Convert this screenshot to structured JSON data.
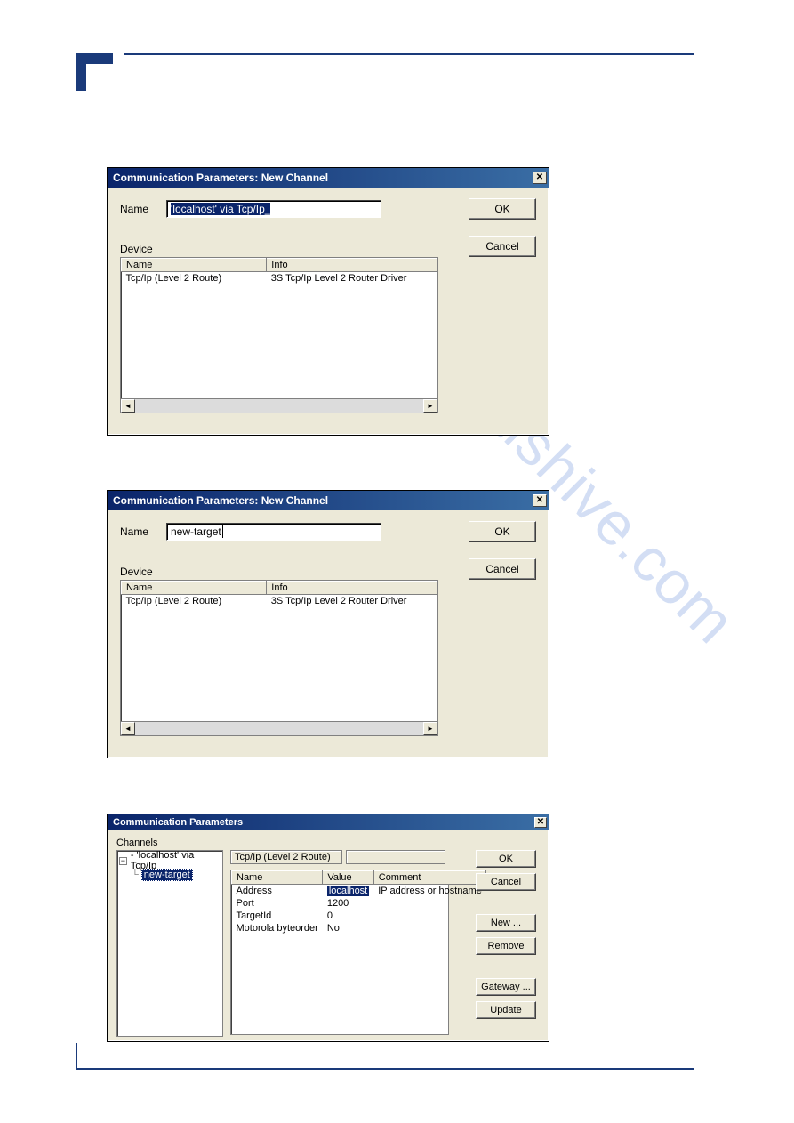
{
  "watermark": "manualshive.com",
  "dialog1": {
    "title": "Communication Parameters: New Channel",
    "name_label": "Name",
    "name_value": "'localhost' via Tcp/Ip_",
    "device_label": "Device",
    "cols": {
      "name": "Name",
      "info": "Info"
    },
    "row": {
      "name": "Tcp/Ip (Level 2 Route)",
      "info": "3S Tcp/Ip Level 2 Router Driver"
    },
    "ok": "OK",
    "cancel": "Cancel",
    "close": "✕"
  },
  "dialog2": {
    "title": "Communication Parameters: New Channel",
    "name_label": "Name",
    "name_value": "new-target",
    "device_label": "Device",
    "cols": {
      "name": "Name",
      "info": "Info"
    },
    "row": {
      "name": "Tcp/Ip (Level 2 Route)",
      "info": "3S Tcp/Ip Level 2 Router Driver"
    },
    "ok": "OK",
    "cancel": "Cancel",
    "close": "✕"
  },
  "dialog3": {
    "title": "Communication Parameters",
    "channels_label": "Channels",
    "tree_root": "- 'localhost' via Tcp/Ip",
    "tree_child": "new-target",
    "panel_hdr": "Tcp/Ip (Level 2 Route)",
    "cols": {
      "name": "Name",
      "value": "Value",
      "comment": "Comment"
    },
    "rows": [
      {
        "name": "Address",
        "value": "localhost",
        "comment": "IP address or hostname"
      },
      {
        "name": "Port",
        "value": "1200",
        "comment": ""
      },
      {
        "name": "TargetId",
        "value": "0",
        "comment": ""
      },
      {
        "name": "Motorola byteorder",
        "value": "No",
        "comment": ""
      }
    ],
    "btns": {
      "ok": "OK",
      "cancel": "Cancel",
      "new": "New ...",
      "remove": "Remove",
      "gateway": "Gateway ...",
      "update": "Update"
    },
    "close": "✕",
    "tree_minus": "−"
  },
  "arrows": {
    "left": "◄",
    "right": "►"
  }
}
